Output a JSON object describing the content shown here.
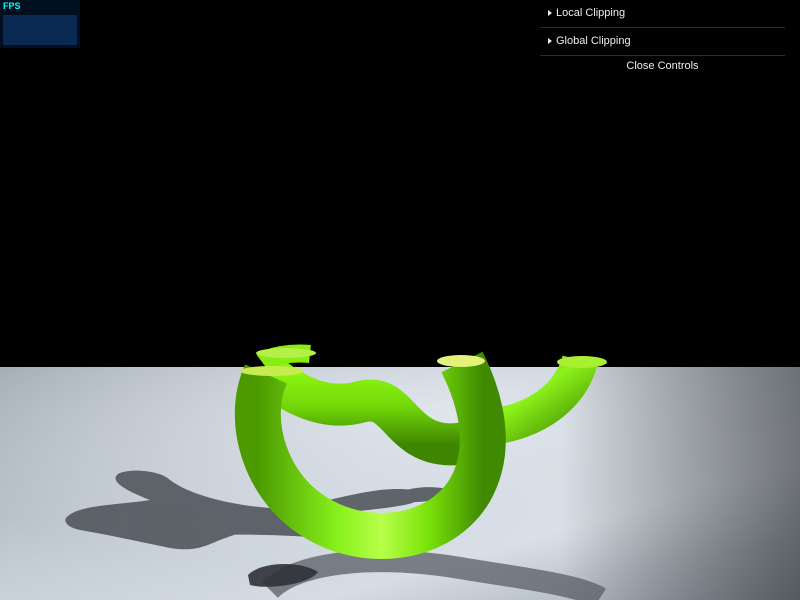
{
  "stats": {
    "label": "FPS"
  },
  "gui": {
    "folders": [
      {
        "title": "Local Clipping"
      },
      {
        "title": "Global Clipping"
      }
    ],
    "close_label": "Close Controls"
  },
  "scene": {
    "background_color": "#000000",
    "floor_color": "#c7d0d8",
    "object_color": "#7be00a",
    "shadow_color": "#4a4e55"
  }
}
